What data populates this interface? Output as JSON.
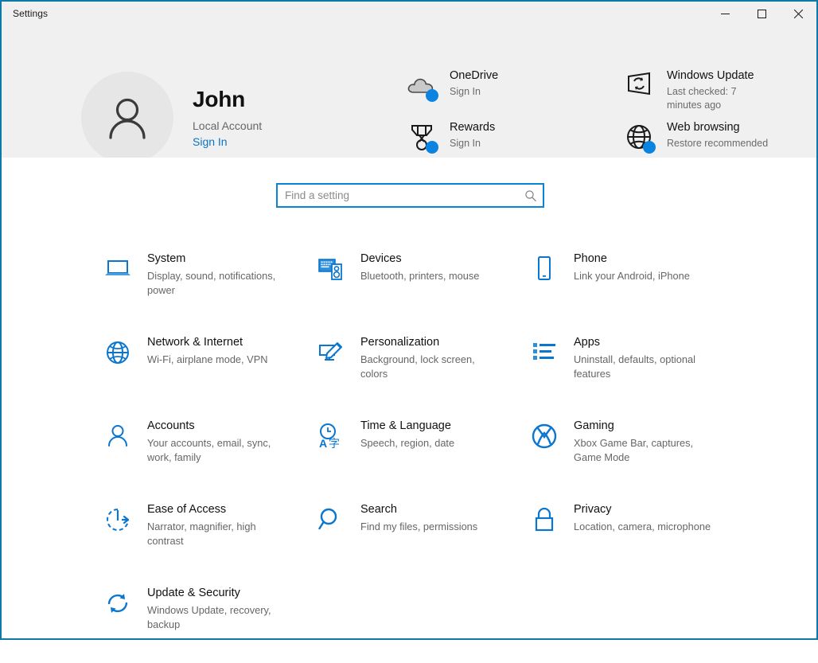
{
  "window": {
    "title": "Settings",
    "controls": {
      "minimize": "minimize-button",
      "maximize": "maximize-button",
      "close": "close-button"
    },
    "border_color": "#0b7aa8"
  },
  "header": {
    "account": {
      "name": "John",
      "type": "Local Account",
      "link": "Sign In",
      "avatar_icon": "person-icon"
    },
    "status_columns": [
      {
        "items": [
          {
            "icon": "onedrive-cloud-icon",
            "title": "OneDrive",
            "sub": "Sign In",
            "badge": true
          },
          {
            "icon": "rewards-medal-icon",
            "title": "Rewards",
            "sub": "Sign In",
            "badge": true
          }
        ]
      },
      {
        "items": [
          {
            "icon": "windows-update-icon",
            "title": "Windows Update",
            "sub": "Last checked: 7 minutes ago",
            "badge": false
          },
          {
            "icon": "web-browsing-globe-icon",
            "title": "Web browsing",
            "sub": "Restore recommended",
            "badge": true
          }
        ]
      }
    ]
  },
  "search": {
    "placeholder": "Find a setting",
    "value": "",
    "icon": "search-icon",
    "border_color": "#0a84d4"
  },
  "tiles": [
    {
      "icon": "laptop-icon",
      "title": "System",
      "sub": "Display, sound, notifications, power"
    },
    {
      "icon": "devices-icon",
      "title": "Devices",
      "sub": "Bluetooth, printers, mouse"
    },
    {
      "icon": "phone-icon",
      "title": "Phone",
      "sub": "Link your Android, iPhone"
    },
    {
      "icon": "globe-icon",
      "title": "Network & Internet",
      "sub": "Wi-Fi, airplane mode, VPN"
    },
    {
      "icon": "paintbrush-icon",
      "title": "Personalization",
      "sub": "Background, lock screen, colors"
    },
    {
      "icon": "apps-list-icon",
      "title": "Apps",
      "sub": "Uninstall, defaults, optional features"
    },
    {
      "icon": "person-icon",
      "title": "Accounts",
      "sub": "Your accounts, email, sync, work, family"
    },
    {
      "icon": "clock-language-icon",
      "title": "Time & Language",
      "sub": "Speech, region, date"
    },
    {
      "icon": "xbox-icon",
      "title": "Gaming",
      "sub": "Xbox Game Bar, captures, Game Mode"
    },
    {
      "icon": "ease-of-access-icon",
      "title": "Ease of Access",
      "sub": "Narrator, magnifier, high contrast"
    },
    {
      "icon": "magnifier-icon",
      "title": "Search",
      "sub": "Find my files, permissions"
    },
    {
      "icon": "lock-icon",
      "title": "Privacy",
      "sub": "Location, camera, microphone"
    },
    {
      "icon": "refresh-shield-icon",
      "title": "Update & Security",
      "sub": "Windows Update, recovery, backup"
    }
  ],
  "colors": {
    "accent_blue": "#0a76d0",
    "badge_blue": "#0a84e0",
    "header_bg": "#f0f0f0",
    "link_blue": "#0b74c4"
  }
}
